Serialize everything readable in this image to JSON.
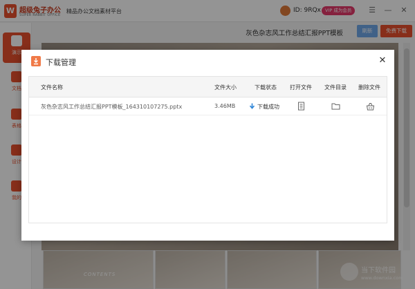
{
  "app": {
    "logo_text": "超级兔子办公",
    "logo_subtext": "SUPER RABBIT OFFICE",
    "logo_mark": "W",
    "tagline": "精品办公文档素材平台",
    "user_id": "ID: 9RQx",
    "vip_badge": "VIP 成为会员",
    "menu_icon": "hamburger-icon",
    "minimize_icon": "minimize-icon",
    "close_icon": "close-icon"
  },
  "sidebar": {
    "items": [
      {
        "label": "演示",
        "icon": "presentation-icon",
        "active": true
      },
      {
        "label": "文档",
        "icon": "document-icon",
        "active": false
      },
      {
        "label": "表格",
        "icon": "table-icon",
        "active": false
      },
      {
        "label": "设计",
        "icon": "design-icon",
        "active": false
      },
      {
        "label": "我的",
        "icon": "user-icon",
        "active": false
      }
    ]
  },
  "document": {
    "title": "灰色杂志风工作总结汇报PPT模板",
    "refresh_label": "刷新",
    "download_label": "免费下载",
    "thumb_text": "CONTENTS"
  },
  "watermark": {
    "text": "当下软件园",
    "url": "www.downxia.com"
  },
  "modal": {
    "title": "下载管理",
    "icon": "download-icon",
    "close_glyph": "✕",
    "columns": {
      "name": "文件名称",
      "size": "文件大小",
      "status": "下载状态",
      "open": "打开文件",
      "folder": "文件目录",
      "delete": "删除文件"
    },
    "rows": [
      {
        "name": "灰色杂志风工作总结汇报PPT模板_164310107275.pptx",
        "size": "3.46MB",
        "status": "下载成功",
        "open_icon": "file-icon",
        "folder_icon": "folder-icon",
        "delete_icon": "trash-icon"
      }
    ]
  },
  "colors": {
    "brand": "#e8502e",
    "link_blue": "#2f86d8",
    "refresh_blue": "#6fa7e8",
    "vip_pink": "#e53a6c"
  }
}
